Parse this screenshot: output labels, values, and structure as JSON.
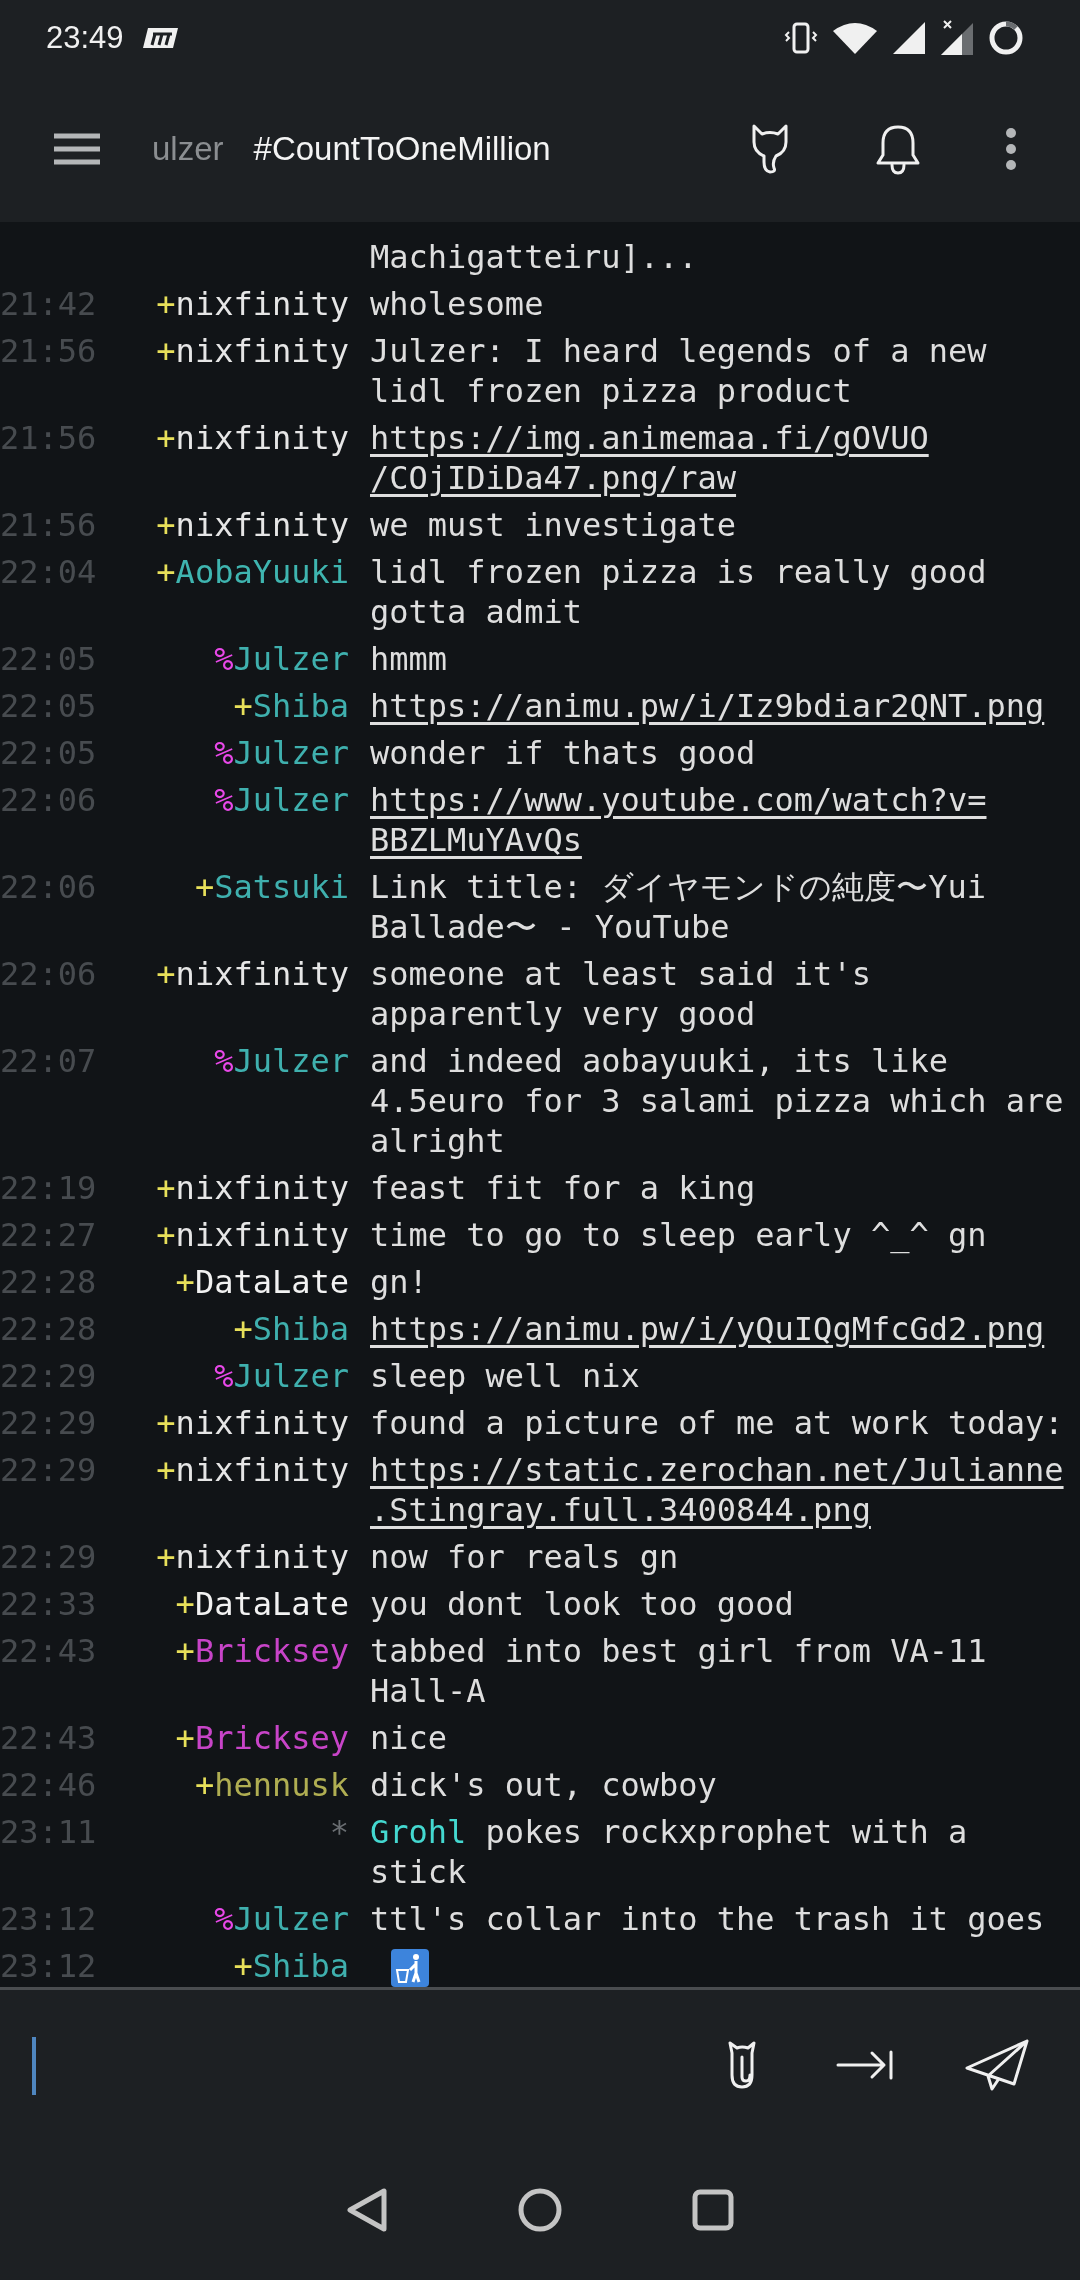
{
  "status_bar": {
    "time": "23:49"
  },
  "toolbar": {
    "previous_channel": "ulzer",
    "title": "#CountToOneMillion"
  },
  "messages": [
    {
      "kind": "continuation",
      "text": "Machigatteiru]..."
    },
    {
      "kind": "text",
      "time": "21:42",
      "mode": {
        "symbol": "+",
        "color": "#e8e05a"
      },
      "nick": "nixfinity",
      "color": "#e6e6e6",
      "text": "wholesome"
    },
    {
      "kind": "text",
      "time": "21:56",
      "mode": {
        "symbol": "+",
        "color": "#e8e05a"
      },
      "nick": "nixfinity",
      "color": "#e6e6e6",
      "text": "Julzer: I heard legends of a new\nlidl frozen pizza product"
    },
    {
      "kind": "link",
      "time": "21:56",
      "mode": {
        "symbol": "+",
        "color": "#e8e05a"
      },
      "nick": "nixfinity",
      "color": "#e6e6e6",
      "text": "https://img.animemaa.fi/gOVUO\n/COjIDiDa47.png/raw"
    },
    {
      "kind": "text",
      "time": "21:56",
      "mode": {
        "symbol": "+",
        "color": "#e8e05a"
      },
      "nick": "nixfinity",
      "color": "#e6e6e6",
      "text": "we must investigate"
    },
    {
      "kind": "text",
      "time": "22:04",
      "mode": {
        "symbol": "+",
        "color": "#e8e05a"
      },
      "nick": "AobaYuuki",
      "color": "#3fb5b0",
      "text": "lidl frozen pizza is really good\ngotta admit"
    },
    {
      "kind": "text",
      "time": "22:05",
      "mode": {
        "symbol": "%",
        "color": "#e848e8"
      },
      "nick": "Julzer",
      "color": "#3fb0ae",
      "text": "hmmm"
    },
    {
      "kind": "link",
      "time": "22:05",
      "mode": {
        "symbol": "+",
        "color": "#e8e05a"
      },
      "nick": "Shiba",
      "color": "#3fb0ae",
      "text": "https://animu.pw/i/Iz9bdiar2QNT.png"
    },
    {
      "kind": "text",
      "time": "22:05",
      "mode": {
        "symbol": "%",
        "color": "#e848e8"
      },
      "nick": "Julzer",
      "color": "#3fb0ae",
      "text": "wonder if thats good"
    },
    {
      "kind": "link",
      "time": "22:06",
      "mode": {
        "symbol": "%",
        "color": "#e848e8"
      },
      "nick": "Julzer",
      "color": "#3fb0ae",
      "text": "https://www.youtube.com/watch?v=\nBBZLMuYAvQs"
    },
    {
      "kind": "text",
      "time": "22:06",
      "mode": {
        "symbol": "+",
        "color": "#e8e05a"
      },
      "nick": "Satsuki",
      "color": "#3fb0ae",
      "text": "Link title: ダイヤモンドの純度〜Yui\nBallade〜 - YouTube"
    },
    {
      "kind": "text",
      "time": "22:06",
      "mode": {
        "symbol": "+",
        "color": "#e8e05a"
      },
      "nick": "nixfinity",
      "color": "#e6e6e6",
      "text": "someone at least said it's\napparently very good"
    },
    {
      "kind": "text",
      "time": "22:07",
      "mode": {
        "symbol": "%",
        "color": "#e848e8"
      },
      "nick": "Julzer",
      "color": "#3fb0ae",
      "text": "and indeed aobayuuki, its like\n4.5euro for 3 salami pizza which are\nalright"
    },
    {
      "kind": "text",
      "time": "22:19",
      "mode": {
        "symbol": "+",
        "color": "#e8e05a"
      },
      "nick": "nixfinity",
      "color": "#e6e6e6",
      "text": "feast fit for a king"
    },
    {
      "kind": "text",
      "time": "22:27",
      "mode": {
        "symbol": "+",
        "color": "#e8e05a"
      },
      "nick": "nixfinity",
      "color": "#e6e6e6",
      "text": "time to go to sleep early ^_^ gn"
    },
    {
      "kind": "text",
      "time": "22:28",
      "mode": {
        "symbol": "+",
        "color": "#e8e05a"
      },
      "nick": "DataLate",
      "color": "#f2f2f2",
      "text": "gn!"
    },
    {
      "kind": "link",
      "time": "22:28",
      "mode": {
        "symbol": "+",
        "color": "#e8e05a"
      },
      "nick": "Shiba",
      "color": "#3fb0ae",
      "text": "https://animu.pw/i/yQuIQgMfcGd2.png"
    },
    {
      "kind": "text",
      "time": "22:29",
      "mode": {
        "symbol": "%",
        "color": "#e848e8"
      },
      "nick": "Julzer",
      "color": "#3fb0ae",
      "text": "sleep well nix"
    },
    {
      "kind": "text",
      "time": "22:29",
      "mode": {
        "symbol": "+",
        "color": "#e8e05a"
      },
      "nick": "nixfinity",
      "color": "#e6e6e6",
      "text": "found a picture of me at work today:"
    },
    {
      "kind": "link",
      "time": "22:29",
      "mode": {
        "symbol": "+",
        "color": "#e8e05a"
      },
      "nick": "nixfinity",
      "color": "#e6e6e6",
      "text": "https://static.zerochan.net/Julianne\n.Stingray.full.3400844.png"
    },
    {
      "kind": "text",
      "time": "22:29",
      "mode": {
        "symbol": "+",
        "color": "#e8e05a"
      },
      "nick": "nixfinity",
      "color": "#e6e6e6",
      "text": "now for reals gn"
    },
    {
      "kind": "text",
      "time": "22:33",
      "mode": {
        "symbol": "+",
        "color": "#e8e05a"
      },
      "nick": "DataLate",
      "color": "#f2f2f2",
      "text": "you dont look too good"
    },
    {
      "kind": "text",
      "time": "22:43",
      "mode": {
        "symbol": "+",
        "color": "#e8e05a"
      },
      "nick": "Bricksey",
      "color": "#c844c8",
      "text": "tabbed into best girl from VA-11\nHall-A"
    },
    {
      "kind": "text",
      "time": "22:43",
      "mode": {
        "symbol": "+",
        "color": "#e8e05a"
      },
      "nick": "Bricksey",
      "color": "#c844c8",
      "text": "nice"
    },
    {
      "kind": "text",
      "time": "22:46",
      "mode": {
        "symbol": "+",
        "color": "#e8e05a"
      },
      "nick": "hennusk",
      "color": "#b0ae52",
      "text": "dick's out, cowboy"
    },
    {
      "kind": "action",
      "time": "23:11",
      "mode": {
        "symbol": "*",
        "color": "#6a6e72"
      },
      "nick": "Grohl",
      "color": "#44d8d0",
      "text": "pokes rockxprophet with a\nstick"
    },
    {
      "kind": "text",
      "time": "23:12",
      "mode": {
        "symbol": "%",
        "color": "#e848e8"
      },
      "nick": "Julzer",
      "color": "#3fb0ae",
      "text": "ttl's collar into the trash it goes"
    },
    {
      "kind": "emoji",
      "time": "23:12",
      "mode": {
        "symbol": "+",
        "color": "#e8e05a"
      },
      "nick": "Shiba",
      "color": "#3fb0ae"
    }
  ]
}
